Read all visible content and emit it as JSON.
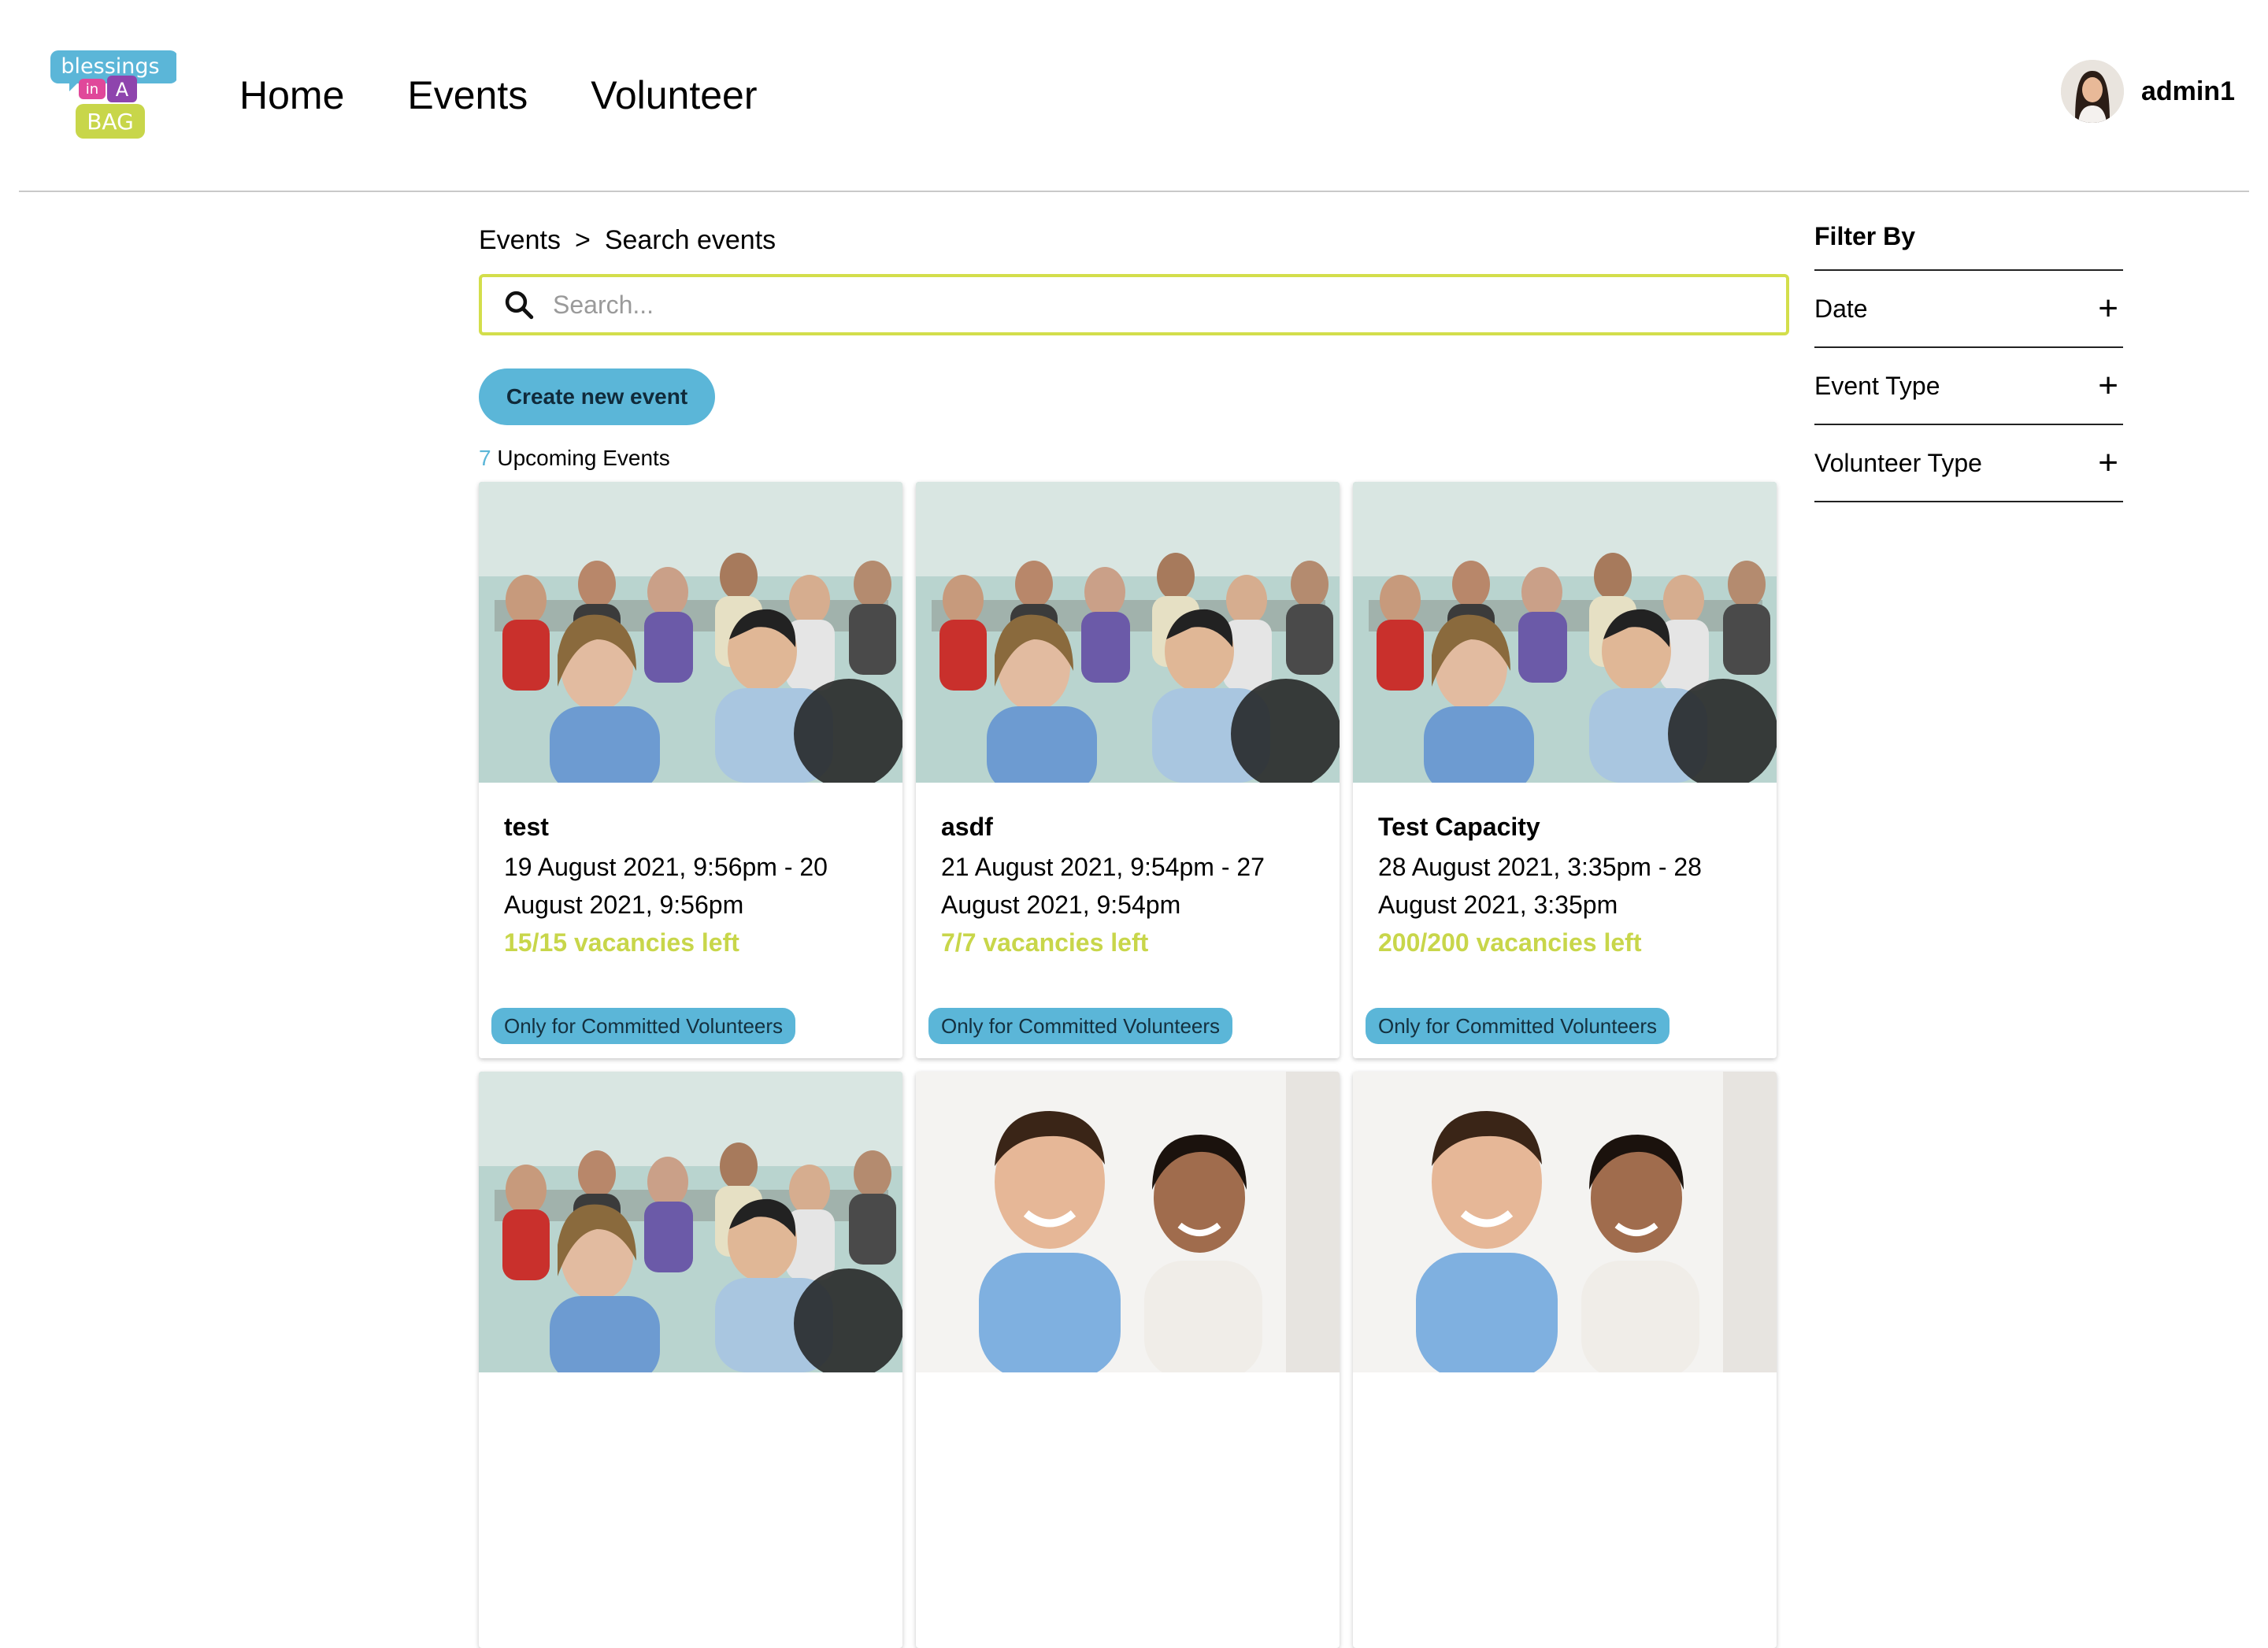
{
  "header": {
    "logo_text": [
      "blessings",
      "in",
      "A",
      "BAG"
    ],
    "nav": [
      "Home",
      "Events",
      "Volunteer"
    ],
    "username": "admin1"
  },
  "breadcrumb": {
    "parent": "Events",
    "separator": ">",
    "current": "Search events"
  },
  "search": {
    "placeholder": "Search...",
    "value": ""
  },
  "create_button": "Create new event",
  "events_count": {
    "number": "7",
    "label": "Upcoming Events"
  },
  "events": [
    {
      "title": "test",
      "date": "19 August 2021, 9:56pm - 20 August 2021, 9:56pm",
      "vacancies": "15/15 vacancies left",
      "badge": "Only for Committed Volunteers",
      "image": "crowd"
    },
    {
      "title": "asdf",
      "date": "21 August 2021, 9:54pm - 27 August 2021, 9:54pm",
      "vacancies": "7/7 vacancies left",
      "badge": "Only for Committed Volunteers",
      "image": "crowd"
    },
    {
      "title": "Test Capacity",
      "date": "28 August 2021, 3:35pm - 28 August 2021, 3:35pm",
      "vacancies": "200/200 vacancies left",
      "badge": "Only for Committed Volunteers",
      "image": "crowd"
    },
    {
      "image": "crowd"
    },
    {
      "image": "smiling-people"
    },
    {
      "image": "smiling-people"
    }
  ],
  "filters": {
    "title": "Filter By",
    "items": [
      "Date",
      "Event Type",
      "Volunteer Type"
    ]
  },
  "colors": {
    "accent_blue": "#5bb6d8",
    "accent_green": "#c8d64a",
    "search_border": "#d3de4b"
  }
}
